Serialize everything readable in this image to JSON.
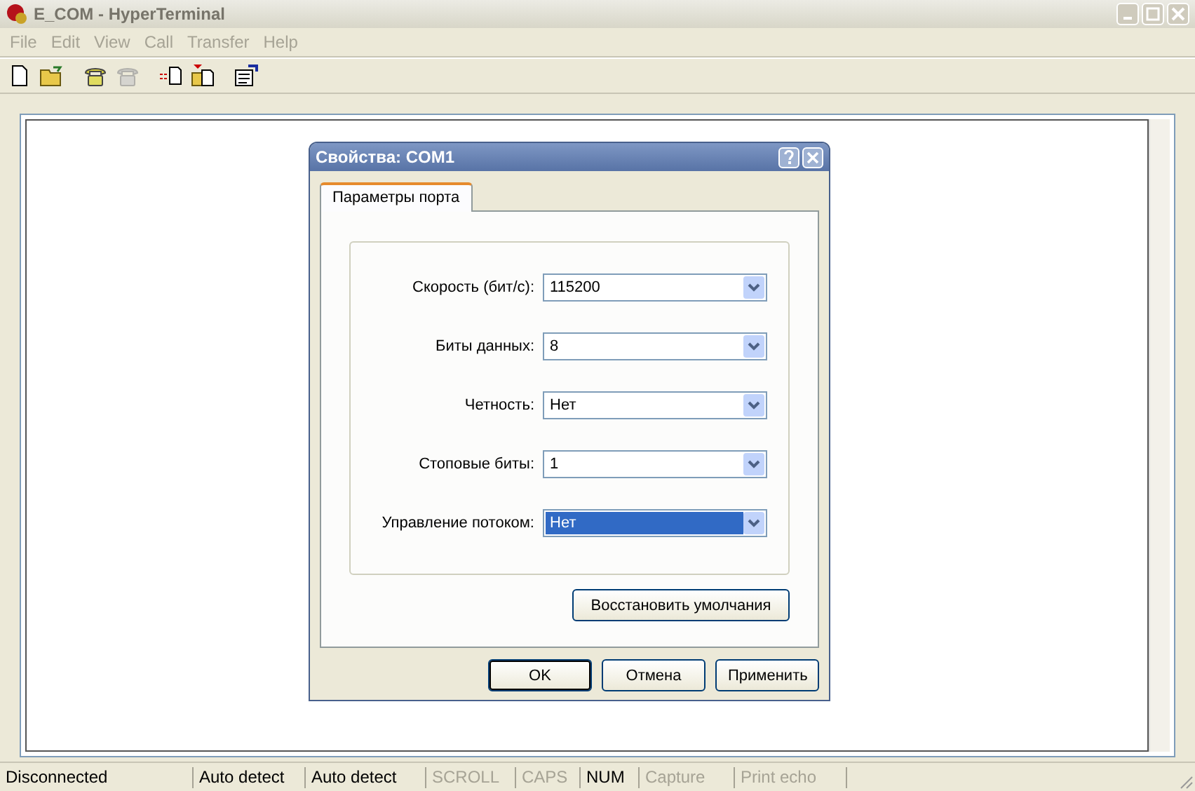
{
  "window": {
    "title": "E_COM - HyperTerminal",
    "active": false
  },
  "menu": [
    {
      "label": "File"
    },
    {
      "label": "Edit"
    },
    {
      "label": "View"
    },
    {
      "label": "Call"
    },
    {
      "label": "Transfer"
    },
    {
      "label": "Help"
    }
  ],
  "toolbar": [
    {
      "kind": "new",
      "disabled": false
    },
    {
      "kind": "open",
      "disabled": false
    },
    {
      "kind": "call",
      "disabled": false
    },
    {
      "kind": "hangup",
      "disabled": true
    },
    {
      "kind": "send",
      "disabled": false
    },
    {
      "kind": "receive",
      "disabled": false
    },
    {
      "kind": "properties",
      "disabled": false
    }
  ],
  "dialog": {
    "title": "Свойства: COM1",
    "tabs": [
      {
        "label": "Параметры порта",
        "selected": true
      }
    ],
    "fields": [
      {
        "label": "Скорость (бит/с):",
        "value": "115200",
        "focused": false
      },
      {
        "label": "Биты данных:",
        "value": "8",
        "focused": false
      },
      {
        "label": "Четность:",
        "value": "Нет",
        "focused": false
      },
      {
        "label": "Стоповые биты:",
        "value": "1",
        "focused": false
      },
      {
        "label": "Управление потоком:",
        "value": "Нет",
        "focused": true
      }
    ],
    "restore_button": "Восстановить умолчания",
    "buttons": [
      {
        "label": "OK",
        "default": true
      },
      {
        "label": "Отмена",
        "default": false
      },
      {
        "label": "Применить",
        "default": false
      }
    ]
  },
  "status_bar": [
    {
      "text": "Disconnected",
      "enabled": true
    },
    {
      "text": "Auto detect",
      "enabled": true
    },
    {
      "text": "Auto detect",
      "enabled": true
    },
    {
      "text": "SCROLL",
      "enabled": false
    },
    {
      "text": "CAPS",
      "enabled": false
    },
    {
      "text": "NUM",
      "enabled": true
    },
    {
      "text": "Capture",
      "enabled": false
    },
    {
      "text": "Print echo",
      "enabled": false
    }
  ]
}
